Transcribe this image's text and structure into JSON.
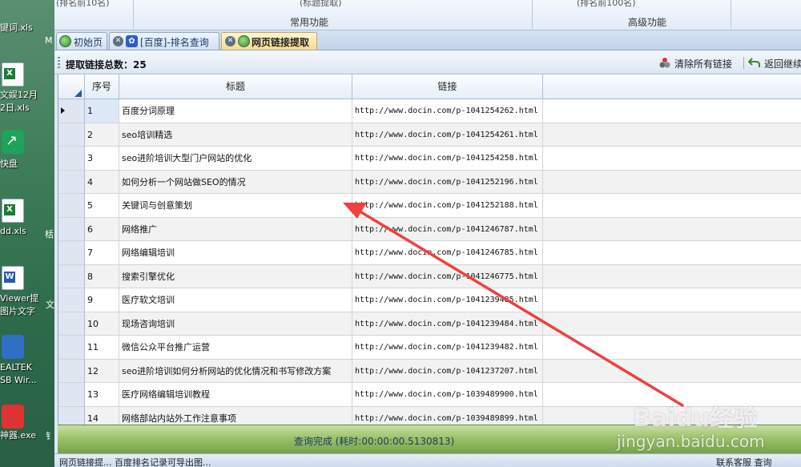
{
  "desktop": {
    "items": [
      {
        "label": "键词.xls",
        "icon": "excel-file-icon"
      },
      {
        "label": "文娱12月",
        "icon": "excel-file-icon"
      },
      {
        "label": "2日.xls",
        "icon": ""
      },
      {
        "label": "快盘",
        "icon": "shortcut-app-icon"
      },
      {
        "label": "dd.xls",
        "icon": "excel-file-icon"
      },
      {
        "label": "Viewer提",
        "icon": "word-file-icon"
      },
      {
        "label": "图片文字",
        "icon": ""
      },
      {
        "label": "EALTEK",
        "icon": "realtek-shortcut-icon"
      },
      {
        "label": "SB Wir...",
        "icon": ""
      },
      {
        "label": "神器.exe",
        "icon": "app-exe-icon"
      }
    ],
    "edge_letters": [
      "M",
      "栝",
      "文",
      "钅"
    ]
  },
  "ribbon": {
    "top_texts": [
      "(排名前10名)",
      "(标题提取)",
      "(排名前100名)"
    ],
    "groups": [
      "常用功能",
      "高级功能"
    ]
  },
  "tabs": [
    {
      "label": "初始页",
      "icon": "globe-icon",
      "active": false
    },
    {
      "label": "[百度]-排名查询",
      "icon": "baidu-paw-icon",
      "active": false
    },
    {
      "label": "网页链接提取",
      "icon": "globe-icon",
      "active": true
    }
  ],
  "toolbar": {
    "count_label": "提取链接总数：25",
    "clear_label": "清除所有链接",
    "back_label": "返回继续"
  },
  "table": {
    "columns": [
      "序号",
      "标题",
      "链接"
    ],
    "rows": [
      {
        "num": "1",
        "title": "百度分词原理",
        "link": "http://www.docin.com/p-1041254262.html"
      },
      {
        "num": "2",
        "title": "seo培训精选",
        "link": "http://www.docin.com/p-1041254261.html"
      },
      {
        "num": "3",
        "title": "seo进阶培训大型门户网站的优化",
        "link": "http://www.docin.com/p-1041254258.html"
      },
      {
        "num": "4",
        "title": "如何分析一个网站做SEO的情况",
        "link": "http://www.docin.com/p-1041252196.html"
      },
      {
        "num": "5",
        "title": "关键词与创意策划",
        "link": "http://www.docin.com/p-1041252188.html"
      },
      {
        "num": "6",
        "title": "网络推广",
        "link": "http://www.docin.com/p-1041246787.html"
      },
      {
        "num": "7",
        "title": "网络编辑培训",
        "link": "http://www.docin.com/p-1041246785.html"
      },
      {
        "num": "8",
        "title": "搜索引擎优化",
        "link": "http://www.docin.com/p-1041246775.html"
      },
      {
        "num": "9",
        "title": "医疗软文培训",
        "link": "http://www.docin.com/p-1041239485.html"
      },
      {
        "num": "10",
        "title": "现场咨询培训",
        "link": "http://www.docin.com/p-1041239484.html"
      },
      {
        "num": "11",
        "title": "微信公众平台推广运营",
        "link": "http://www.docin.com/p-1041239482.html"
      },
      {
        "num": "12",
        "title": "seo进阶培训如何分析网站的优化情况和书写修改方案",
        "link": "http://www.docin.com/p-1041237207.html"
      },
      {
        "num": "13",
        "title": "医疗网络编辑培训教程",
        "link": "http://www.docin.com/p-1039489900.html"
      },
      {
        "num": "14",
        "title": "网络部站内站外工作注意事项",
        "link": "http://www.docin.com/p-1039489899.html"
      }
    ]
  },
  "status": {
    "text": "查询完成 (耗时:00:00:00.5130813)"
  },
  "bottombar": {
    "left_text": "网页链接提... 百度排名记录可导出图...",
    "right_text": "联系客服 查询"
  },
  "watermark": {
    "brand": "Baidu经验",
    "domain": "jingyan.baidu.com"
  },
  "colors": {
    "accent_tab": "#ffd98a",
    "status_green": "#9cc26a",
    "arrow_red": "#f04040",
    "header_blue": "#dfe8f6"
  }
}
